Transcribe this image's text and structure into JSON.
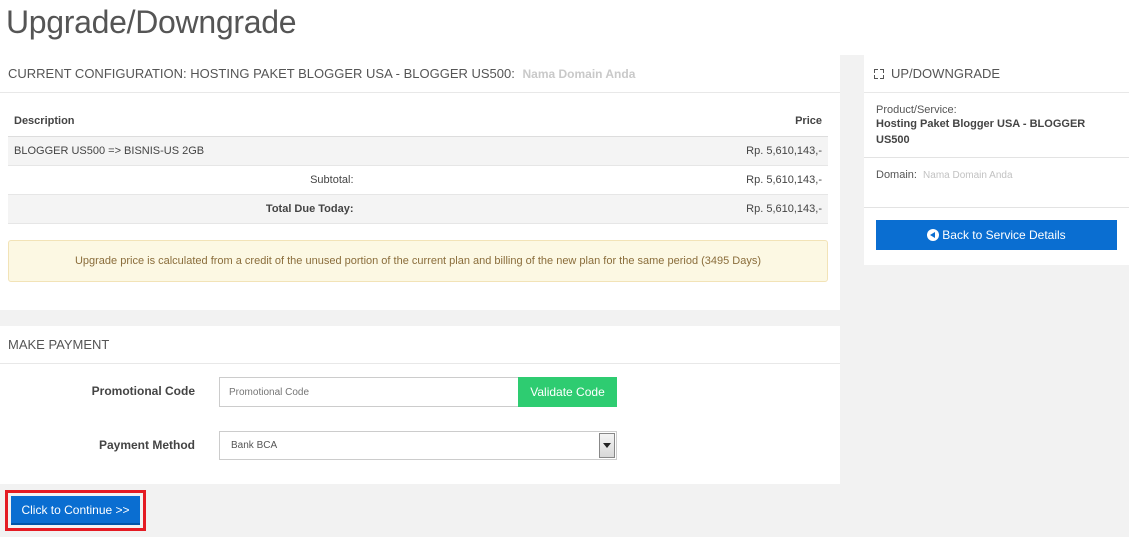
{
  "page": {
    "title": "Upgrade/Downgrade"
  },
  "config": {
    "heading": "CURRENT CONFIGURATION: HOSTING PAKET BLOGGER USA - BLOGGER US500:",
    "domain_hint": "Nama Domain Anda",
    "table": {
      "headers": {
        "description": "Description",
        "price": "Price"
      },
      "item": {
        "description": "BLOGGER US500 => BISNIS-US 2GB",
        "price": "Rp. 5,610,143,-"
      },
      "subtotal": {
        "label": "Subtotal:",
        "value": "Rp. 5,610,143,-"
      },
      "total": {
        "label": "Total Due Today:",
        "value": "Rp. 5,610,143,-"
      }
    },
    "alert": "Upgrade price is calculated from a credit of the unused portion of the current plan and billing of the new plan for the same period (3495 Days)"
  },
  "payment": {
    "heading": "MAKE PAYMENT",
    "promo_label": "Promotional Code",
    "promo_placeholder": "Promotional Code",
    "validate_label": "Validate Code",
    "method_label": "Payment Method",
    "method_selected": "Bank BCA",
    "continue_label": "Click to Continue >>"
  },
  "sidebar": {
    "heading": "UP/DOWNGRADE",
    "product_label": "Product/Service:",
    "product_value": "Hosting Paket Blogger USA - BLOGGER US500",
    "domain_label": "Domain:",
    "domain_value": "Nama Domain Anda",
    "back_label": "Back to Service Details"
  },
  "colors": {
    "primary": "#0a6ed1",
    "success": "#2ecc71",
    "highlight": "#e41b23",
    "alert_bg": "#fcf8e3"
  }
}
